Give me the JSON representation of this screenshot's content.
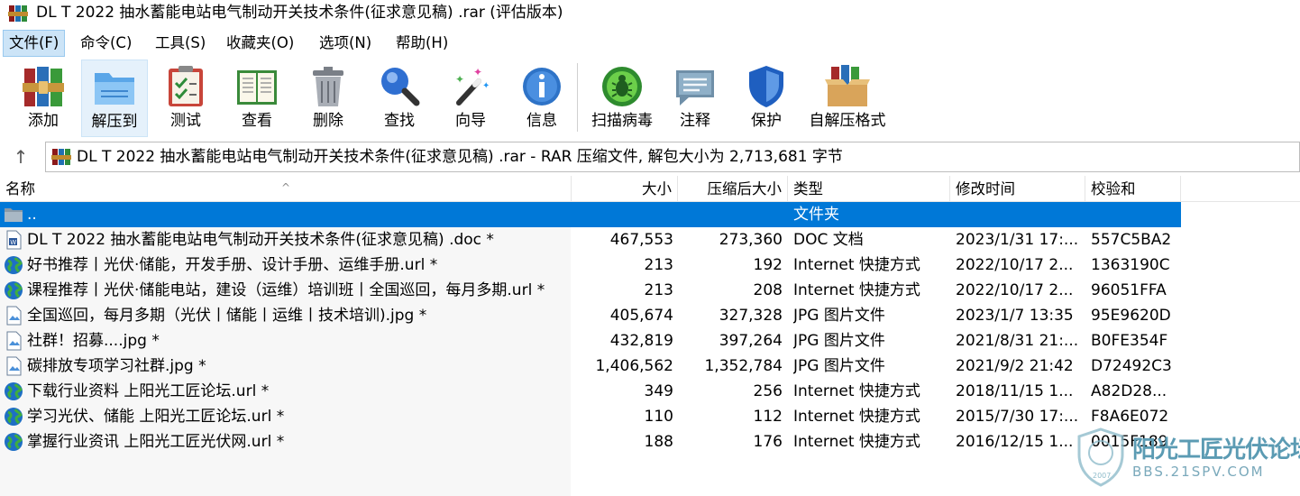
{
  "window": {
    "title": "DL T 2022 抽水蓄能电站电气制动开关技术条件(征求意见稿)  .rar (评估版本)"
  },
  "menu": [
    {
      "label": "文件(F)",
      "active": true
    },
    {
      "label": "命令(C)"
    },
    {
      "label": "工具(S)"
    },
    {
      "label": "收藏夹(O)"
    },
    {
      "label": "选项(N)"
    },
    {
      "label": "帮助(H)"
    }
  ],
  "toolbar": [
    {
      "label": "添加",
      "icon": "rar-books-icon"
    },
    {
      "label": "解压到",
      "icon": "folder-extract-icon",
      "active": true
    },
    {
      "label": "测试",
      "icon": "clipboard-check-icon"
    },
    {
      "label": "查看",
      "icon": "open-book-icon"
    },
    {
      "label": "删除",
      "icon": "trash-can-icon"
    },
    {
      "label": "查找",
      "icon": "magnifier-icon"
    },
    {
      "label": "向导",
      "icon": "magic-wand-icon"
    },
    {
      "label": "信息",
      "icon": "info-icon"
    },
    {
      "label": "扫描病毒",
      "icon": "virus-scan-icon"
    },
    {
      "label": "注释",
      "icon": "comment-icon"
    },
    {
      "label": "保护",
      "icon": "shield-icon"
    },
    {
      "label": "自解压格式",
      "icon": "sfx-box-icon"
    }
  ],
  "address": {
    "text": "DL T 2022 抽水蓄能电站电气制动开关技术条件(征求意见稿)  .rar - RAR 压缩文件, 解包大小为 2,713,681 字节"
  },
  "columns": {
    "name": "名称",
    "size": "大小",
    "packed": "压缩后大小",
    "type": "类型",
    "mtime": "修改时间",
    "crc": "校验和"
  },
  "rows": [
    {
      "icon": "parent-folder-icon",
      "name": "..",
      "size": "",
      "packed": "",
      "type": "文件夹",
      "mtime": "",
      "crc": "",
      "selected": true
    },
    {
      "icon": "word-doc-icon",
      "name": "DL T 2022 抽水蓄能电站电气制动开关技术条件(征求意见稿)  .doc *",
      "size": "467,553",
      "packed": "273,360",
      "type": "DOC 文档",
      "mtime": "2023/1/31 17:...",
      "crc": "557C5BA2"
    },
    {
      "icon": "globe-url-icon",
      "name": "好书推荐丨光伏·储能，开发手册、设计手册、运维手册.url *",
      "size": "213",
      "packed": "192",
      "type": "Internet 快捷方式",
      "mtime": "2022/10/17 2...",
      "crc": "1363190C"
    },
    {
      "icon": "globe-url-icon",
      "name": "课程推荐丨光伏·储能电站，建设（运维）培训班丨全国巡回，每月多期.url *",
      "size": "213",
      "packed": "208",
      "type": "Internet 快捷方式",
      "mtime": "2022/10/17 2...",
      "crc": "96051FFA"
    },
    {
      "icon": "image-file-icon",
      "name": "全国巡回，每月多期（光伏丨储能丨运维丨技术培训).jpg *",
      "size": "405,674",
      "packed": "327,328",
      "type": "JPG 图片文件",
      "mtime": "2023/1/7 13:35",
      "crc": "95E9620D"
    },
    {
      "icon": "image-file-icon",
      "name": "社群！招募....jpg *",
      "size": "432,819",
      "packed": "397,264",
      "type": "JPG 图片文件",
      "mtime": "2021/8/31 21:...",
      "crc": "B0FE354F"
    },
    {
      "icon": "image-file-icon",
      "name": "碳排放专项学习社群.jpg *",
      "size": "1,406,562",
      "packed": "1,352,784",
      "type": "JPG 图片文件",
      "mtime": "2021/9/2 21:42",
      "crc": "D72492C3"
    },
    {
      "icon": "globe-url-icon",
      "name": "下载行业资料 上阳光工匠论坛.url *",
      "size": "349",
      "packed": "256",
      "type": "Internet 快捷方式",
      "mtime": "2018/11/15 1...",
      "crc": "A82D28..."
    },
    {
      "icon": "globe-url-icon",
      "name": "学习光伏、储能 上阳光工匠论坛.url *",
      "size": "110",
      "packed": "112",
      "type": "Internet 快捷方式",
      "mtime": "2015/7/30 17:...",
      "crc": "F8A6E072"
    },
    {
      "icon": "globe-url-icon",
      "name": "掌握行业资讯 上阳光工匠光伏网.url *",
      "size": "188",
      "packed": "176",
      "type": "Internet 快捷方式",
      "mtime": "2016/12/15 1...",
      "crc": "0015F189"
    }
  ],
  "watermark": {
    "title": "阳光工匠光伏论坛",
    "url": "BBS.21SPV.COM",
    "year": "2007"
  },
  "colors": {
    "selection": "#0078d7",
    "menu_active": "#cce4f7",
    "watermark": "#5b9bb3"
  }
}
